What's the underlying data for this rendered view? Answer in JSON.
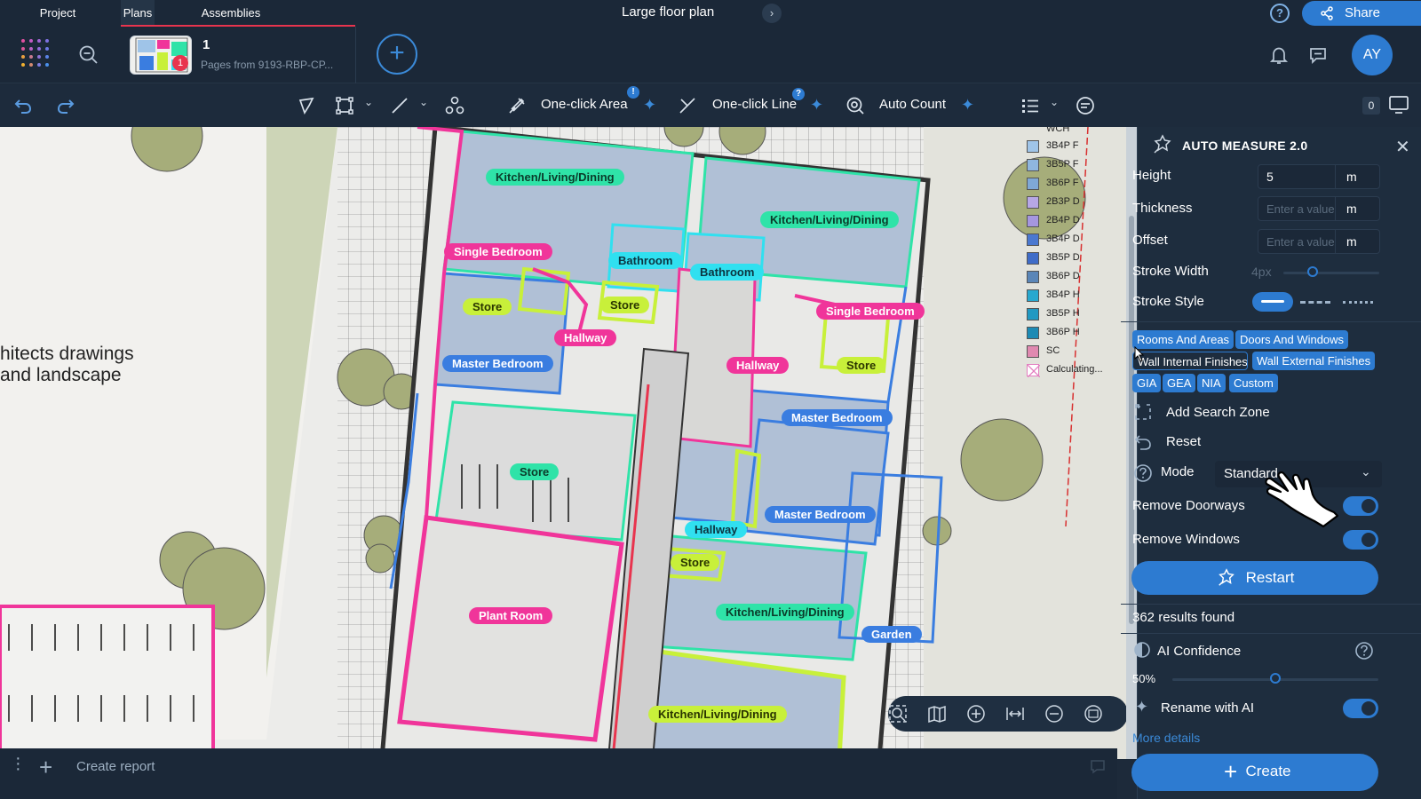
{
  "topbar": {
    "tabs": [
      {
        "label": "Project"
      },
      {
        "label": "Plans"
      },
      {
        "label": "Assemblies"
      }
    ],
    "document_title": "Large floor plan",
    "share_label": "Share",
    "help_label": "?"
  },
  "planbar": {
    "plan_number": "1",
    "plan_subtitle": "Pages from 9193-RBP-CP...",
    "badge_count": "1",
    "avatar_initials": "AY"
  },
  "toolbar": {
    "one_click_area": "One-click Area",
    "one_click_area_badge": "!",
    "one_click_line": "One-click Line",
    "one_click_line_badge": "?",
    "auto_count": "Auto Count",
    "count_value": "0"
  },
  "canvas": {
    "background_text": "hitects drawings\nand landscape",
    "room_tags": [
      {
        "label": "Kitchen/Living/Dining",
        "style": "green"
      },
      {
        "label": "Kitchen/Living/Dining",
        "style": "green"
      },
      {
        "label": "Single Bedroom",
        "style": "pink"
      },
      {
        "label": "Bathroom",
        "style": "cyan"
      },
      {
        "label": "Bathroom",
        "style": "cyan"
      },
      {
        "label": "Store",
        "style": "lime"
      },
      {
        "label": "Store",
        "style": "lime"
      },
      {
        "label": "Single Bedroom",
        "style": "pink"
      },
      {
        "label": "Hallway",
        "style": "pink"
      },
      {
        "label": "Master Bedroom",
        "style": "blue"
      },
      {
        "label": "Hallway",
        "style": "pink"
      },
      {
        "label": "Store",
        "style": "lime"
      },
      {
        "label": "Master Bedroom",
        "style": "blue"
      },
      {
        "label": "Store",
        "style": "green"
      },
      {
        "label": "Master Bedroom",
        "style": "blue"
      },
      {
        "label": "Hallway",
        "style": "cyan"
      },
      {
        "label": "Store",
        "style": "lime"
      },
      {
        "label": "Plant Room",
        "style": "pink"
      },
      {
        "label": "Kitchen/Living/Dining",
        "style": "green"
      },
      {
        "label": "Garden",
        "style": "blue"
      },
      {
        "label": "Kitchen/Living/Dining",
        "style": "lime"
      }
    ],
    "legend": [
      {
        "label": "WCH",
        "color": "#ffffff"
      },
      {
        "label": "3B4P F",
        "color": "#9fc4e8"
      },
      {
        "label": "3B5P F",
        "color": "#8fb6df"
      },
      {
        "label": "3B6P F",
        "color": "#7fa8d6"
      },
      {
        "label": "2B3P D",
        "color": "#b7a7e6"
      },
      {
        "label": "2B4P D",
        "color": "#a596df"
      },
      {
        "label": "3B4P D",
        "color": "#4a78d0"
      },
      {
        "label": "3B5P D",
        "color": "#3f6cc8"
      },
      {
        "label": "3B6P D",
        "color": "#5a86b8"
      },
      {
        "label": "3B4P H",
        "color": "#27a8cf"
      },
      {
        "label": "3B5P H",
        "color": "#2199c2"
      },
      {
        "label": "3B6P H",
        "color": "#1c8ab4"
      },
      {
        "label": "SC",
        "color": "#e089b0"
      },
      {
        "label": "Calculating...",
        "color": "#e37fc0"
      }
    ]
  },
  "panel": {
    "title": "AUTO MEASURE 2.0",
    "height": {
      "label": "Height",
      "value": "5",
      "unit": "m"
    },
    "thickness": {
      "label": "Thickness",
      "placeholder": "Enter a value",
      "unit": "m"
    },
    "offset": {
      "label": "Offset",
      "placeholder": "Enter a value",
      "unit": "m"
    },
    "stroke_width": {
      "label": "Stroke Width",
      "value": "4px"
    },
    "stroke_style": {
      "label": "Stroke Style"
    },
    "chips": [
      "Rooms And Areas",
      "Doors And Windows",
      "Wall Internal Finishes",
      "Wall External Finishes",
      "GIA",
      "GEA",
      "NIA",
      "Custom"
    ],
    "add_search_zone": "Add Search Zone",
    "reset": "Reset",
    "mode": {
      "label": "Mode",
      "value": "Standard"
    },
    "remove_doorways": "Remove Doorways",
    "remove_windows": "Remove Windows",
    "restart": "Restart",
    "results": "362 results found",
    "ai_confidence": {
      "label": "AI Confidence",
      "value": "50%",
      "level": 0.5
    },
    "rename_with_ai": "Rename with AI",
    "more_details": "More details",
    "create": "Create"
  },
  "bottombar": {
    "create_report": "Create report"
  }
}
